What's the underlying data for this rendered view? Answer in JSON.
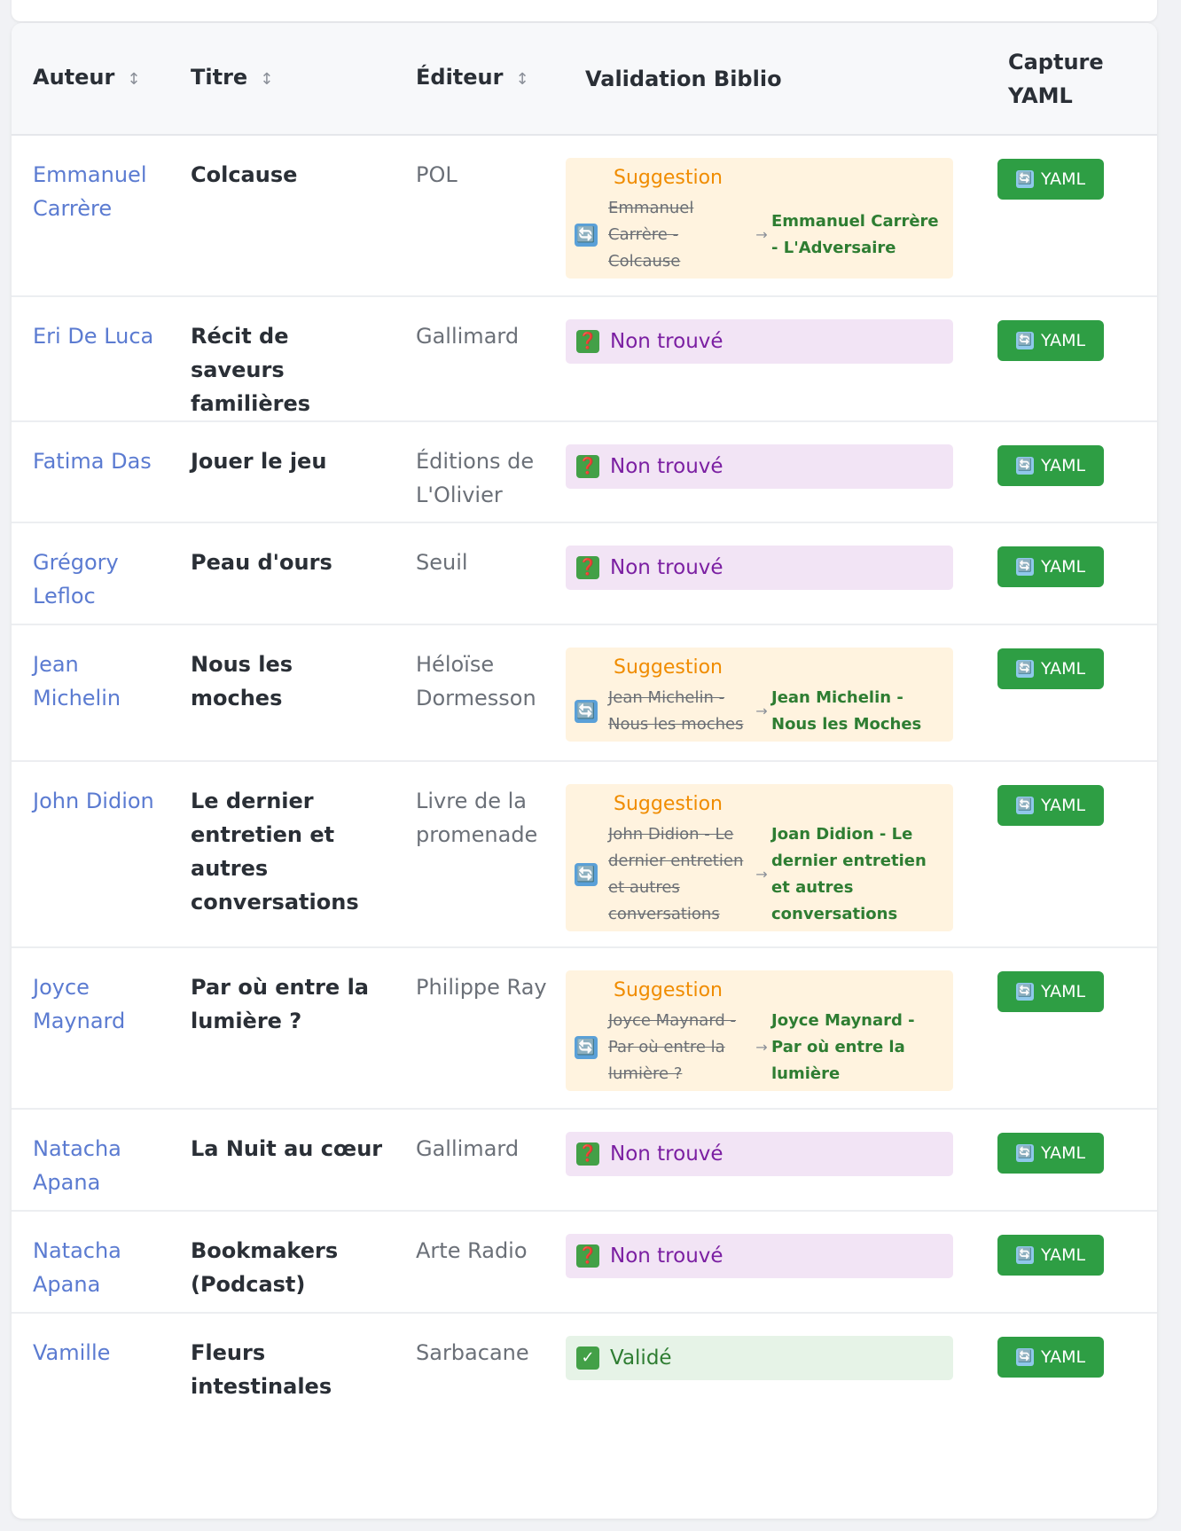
{
  "table": {
    "headers": {
      "auteur": "Auteur",
      "titre": "Titre",
      "editeur": "Éditeur",
      "validation": "Validation Biblio",
      "capture": "Capture YAML"
    },
    "sort_icon": "↕",
    "yaml_label": "YAML",
    "yaml_icon": "🔄",
    "suggestion_label": "Suggestion",
    "suggestion_icon": "🔄",
    "arrow": "→",
    "rows": [
      {
        "author": "Emmanuel Carrère",
        "title": "Colcause",
        "publisher": "POL",
        "status": "suggestion",
        "old": "Emmanuel Carrère - Colcause",
        "new": "Emmanuel Carrère - L'Adversaire"
      },
      {
        "author": "Eri De Luca",
        "title": "Récit de saveurs familières",
        "publisher": "Gallimard",
        "status": "notfound",
        "status_text": "Non trouvé"
      },
      {
        "author": "Fatima Das",
        "title": "Jouer le jeu",
        "publisher": "Éditions de L'Olivier",
        "status": "notfound",
        "status_text": "Non trouvé"
      },
      {
        "author": "Grégory Lefloc",
        "title": "Peau d'ours",
        "publisher": "Seuil",
        "status": "notfound",
        "status_text": "Non trouvé"
      },
      {
        "author": "Jean Michelin",
        "title": "Nous les moches",
        "publisher": "Héloïse Dormesson",
        "status": "suggestion",
        "old": "Jean Michelin - Nous les moches",
        "new": "Jean Michelin - Nous les Moches"
      },
      {
        "author": "John Didion",
        "title": "Le dernier entretien et autres conversations",
        "publisher": "Livre de la promenade",
        "status": "suggestion",
        "old": "John Didion - Le dernier entretien et autres conversations",
        "new": "Joan Didion - Le dernier entretien et autres conversations"
      },
      {
        "author": "Joyce Maynard",
        "title": "Par où entre la lumière ?",
        "publisher": "Philippe Ray",
        "status": "suggestion",
        "old": "Joyce Maynard - Par où entre la lumière ?",
        "new": "Joyce Maynard - Par où entre la lumière"
      },
      {
        "author": "Natacha Apana",
        "title": "La Nuit au cœur",
        "publisher": "Gallimard",
        "status": "notfound",
        "status_text": "Non trouvé"
      },
      {
        "author": "Natacha Apana",
        "title": "Bookmakers (Podcast)",
        "publisher": "Arte Radio",
        "status": "notfound",
        "status_text": "Non trouvé"
      },
      {
        "author": "Vamille",
        "title": "Fleurs intestinales",
        "publisher": "Sarbacane",
        "status": "valid",
        "status_text": "Validé"
      }
    ]
  },
  "colors": {
    "author_link": "#5b7bd1",
    "suggestion_bg": "#fff3df",
    "suggestion_title": "#f08c00",
    "suggested_value": "#2e7d32",
    "notfound_bg": "#f2e4f5",
    "notfound_text": "#7b1fa2",
    "valid_bg": "#e6f3e7",
    "yaml_button": "#2e9e44"
  },
  "icons": {
    "notfound": "❓",
    "valid": "✓"
  }
}
